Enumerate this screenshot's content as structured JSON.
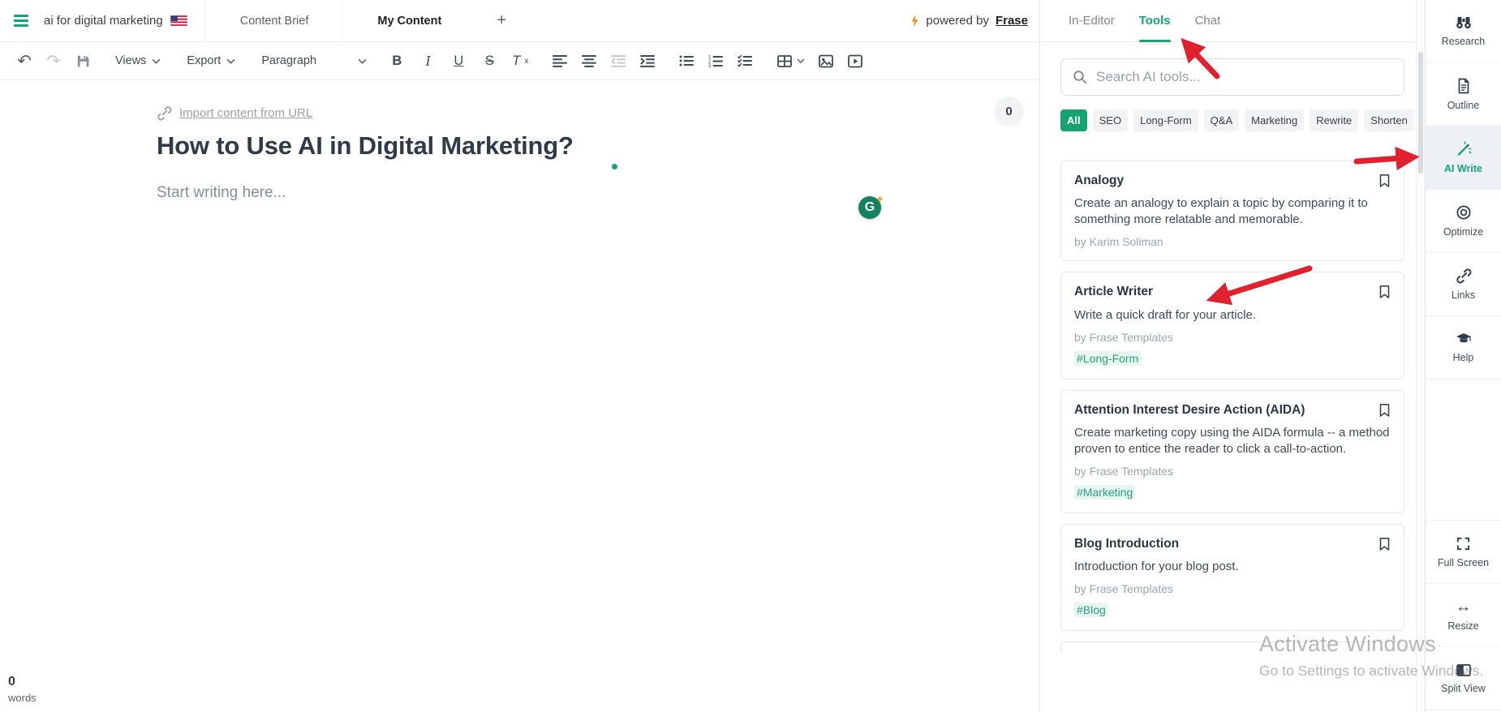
{
  "colors": {
    "accent": "#14a47b",
    "chip_active_bg": "#17a371",
    "arrow_red": "#df222e",
    "tag_text": "#2aa183",
    "tag_bg": "#e7f6f0",
    "bolt_orange": "#f0962e",
    "grammarly_green": "#15825f"
  },
  "header": {
    "doc_title": "ai for digital marketing",
    "tab_content_brief": "Content Brief",
    "tab_my_content": "My Content",
    "add_tab": "+",
    "powered_by_prefix": "powered by",
    "powered_by_brand": "Frase"
  },
  "toolbar": {
    "views": "Views",
    "export": "Export",
    "paragraph": "Paragraph",
    "bold": "B",
    "italic": "I",
    "underline": "U",
    "strikethrough": "S",
    "clear_format_t": "T",
    "clear_format_x": "x",
    "undo_glyph": "↶",
    "redo_glyph": "↷"
  },
  "editor": {
    "import_link": "Import content from URL",
    "title": "How to Use AI in Digital Marketing?",
    "placeholder": "Start writing here...",
    "revision_badge": "0",
    "grammarly_letter": "G",
    "word_count_value": "0",
    "word_count_label": "words"
  },
  "panel": {
    "tab_in_editor": "In-Editor",
    "tab_tools": "Tools",
    "tab_chat": "Chat",
    "search_placeholder": "Search AI tools...",
    "filters": [
      {
        "label": "All",
        "active": true
      },
      {
        "label": "SEO"
      },
      {
        "label": "Long-Form"
      },
      {
        "label": "Q&A"
      },
      {
        "label": "Marketing"
      },
      {
        "label": "Rewrite"
      },
      {
        "label": "Shorten"
      }
    ],
    "tools": [
      {
        "title": "Analogy",
        "description": "Create an analogy to explain a topic by comparing it to something more relatable and memorable.",
        "author": "by Karim Soliman"
      },
      {
        "title": "Article Writer",
        "description": "Write a quick draft for your article.",
        "author": "by Frase Templates",
        "tag": "#Long-Form"
      },
      {
        "title": "Attention Interest Desire Action (AIDA)",
        "description": "Create marketing copy using the AIDA formula -- a method proven to entice the reader to click a call-to-action.",
        "author": "by Frase Templates",
        "tag": "#Marketing"
      },
      {
        "title": "Blog Introduction",
        "description": "Introduction for your blog post.",
        "author": "by Frase Templates",
        "tag": "#Blog"
      }
    ]
  },
  "sidebar": {
    "items": [
      {
        "label": "Research"
      },
      {
        "label": "Outline"
      },
      {
        "label": "AI Write",
        "active": true
      },
      {
        "label": "Optimize"
      },
      {
        "label": "Links"
      },
      {
        "label": "Help"
      }
    ],
    "bottom_items": [
      {
        "label": "Full Screen"
      },
      {
        "label": "Resize"
      },
      {
        "label": "Split View"
      }
    ]
  },
  "watermark": {
    "line1": "Activate Windows",
    "line2": "Go to Settings to activate Windows."
  }
}
